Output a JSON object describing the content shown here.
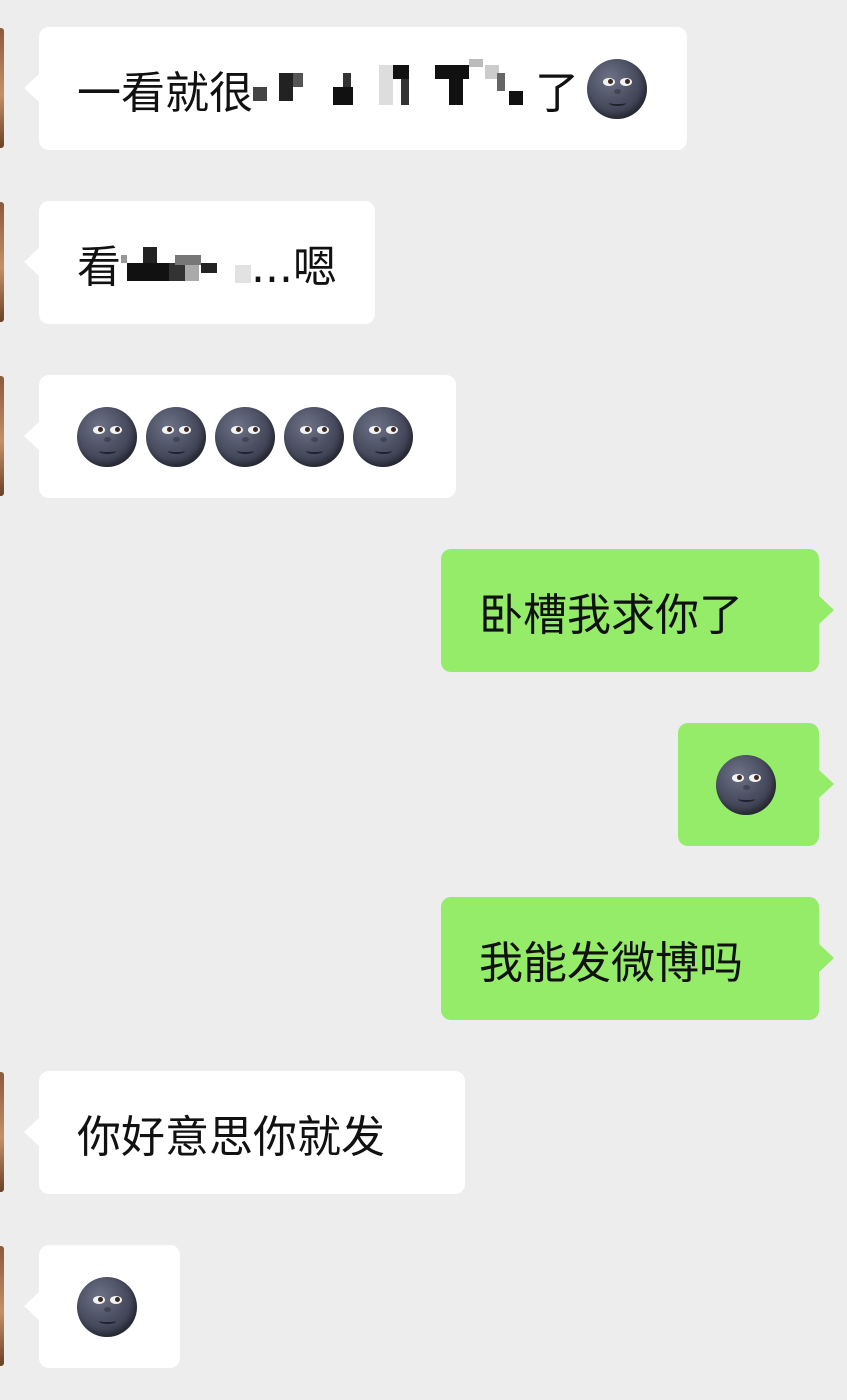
{
  "conversation": {
    "messages": [
      {
        "side": "received",
        "before": "一看就很",
        "redacted": true,
        "after": "了",
        "emoji": "moon-face-icon"
      },
      {
        "side": "received",
        "before": "看",
        "redacted": true,
        "after": "...嗯"
      },
      {
        "side": "received",
        "emoji": "moon-face-icon",
        "emoji_count": 5
      },
      {
        "side": "sent",
        "text": "卧槽我求你了"
      },
      {
        "side": "sent",
        "emoji": "moon-face-icon"
      },
      {
        "side": "sent",
        "text": "我能发微博吗"
      },
      {
        "side": "received",
        "text": "你好意思你就发"
      },
      {
        "side": "received",
        "emoji": "moon-face-icon"
      }
    ]
  },
  "colors": {
    "background": "#ededed",
    "received_bubble": "#ffffff",
    "sent_bubble": "#95ec69",
    "text": "#111111"
  }
}
